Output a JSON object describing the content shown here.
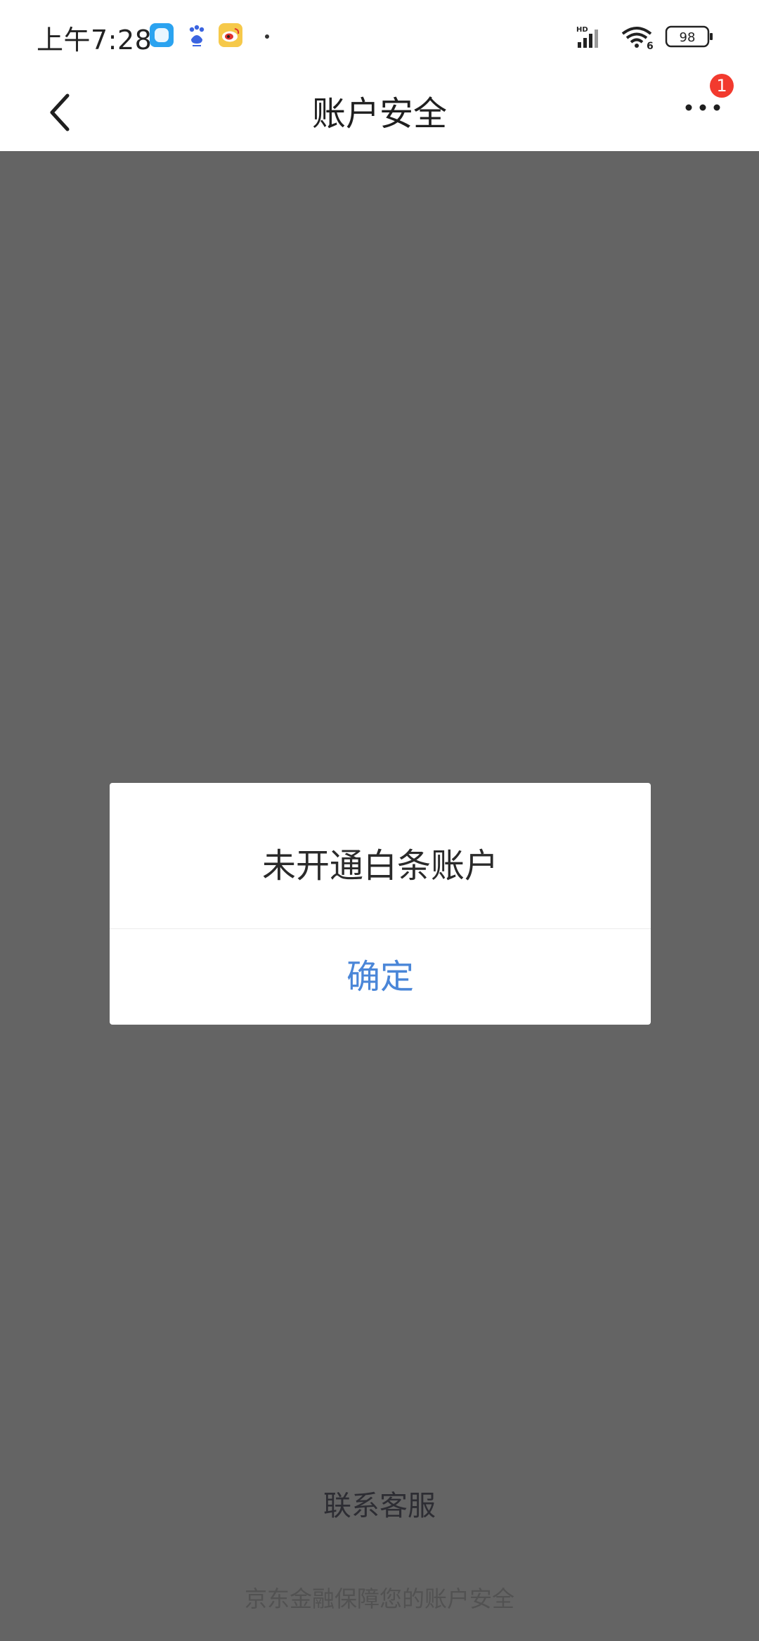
{
  "status_bar": {
    "time": "上午7:28",
    "icons": [
      "qq-icon",
      "baidu-icon",
      "weibo-icon"
    ],
    "network_label": "HD",
    "wifi_label": "6",
    "battery": "98"
  },
  "nav": {
    "title": "账户安全",
    "badge_count": "1"
  },
  "dialog": {
    "message": "未开通白条账户",
    "confirm_label": "确定"
  },
  "footer": {
    "contact_label": "联系客服",
    "note": "京东金融保障您的账户安全"
  },
  "colors": {
    "overlay": "#646464",
    "accent": "#4a86d8",
    "badge": "#f23a2e"
  }
}
